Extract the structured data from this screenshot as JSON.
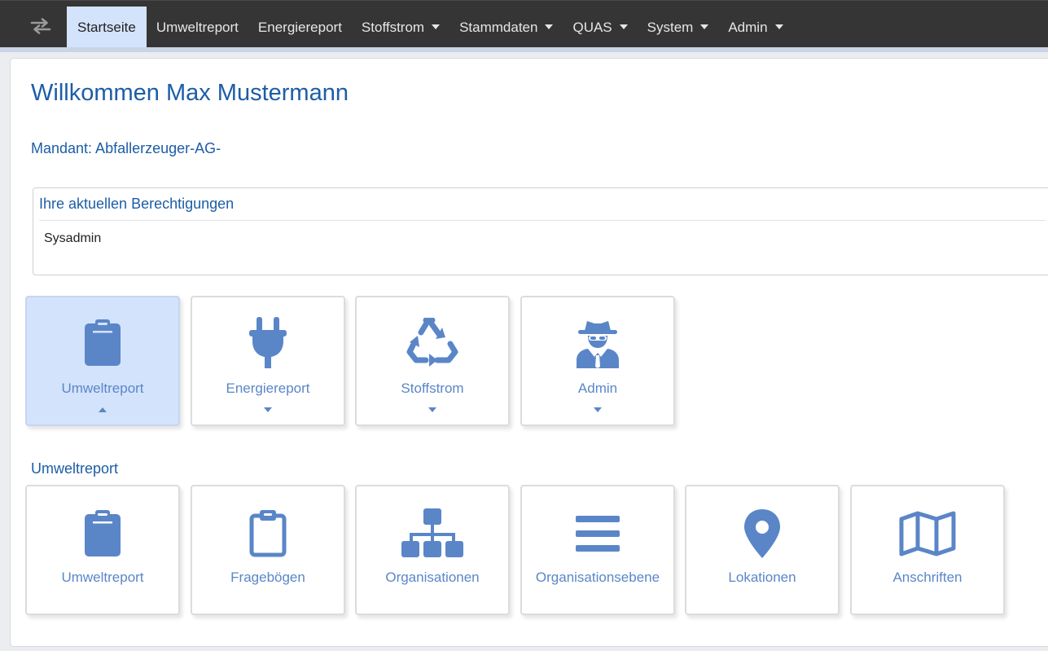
{
  "nav": {
    "toggle_icon": "exchange-arrows-icon",
    "items": [
      {
        "label": "Startseite",
        "active": true,
        "dropdown": false
      },
      {
        "label": "Umweltreport",
        "dropdown": false
      },
      {
        "label": "Energiereport",
        "dropdown": false
      },
      {
        "label": "Stoffstrom",
        "dropdown": true
      },
      {
        "label": "Stammdaten",
        "dropdown": true
      },
      {
        "label": "QUAS",
        "dropdown": true
      },
      {
        "label": "System",
        "dropdown": true
      },
      {
        "label": "Admin",
        "dropdown": true
      }
    ]
  },
  "welcome": "Willkommen Max Mustermann",
  "mandant": "Mandant: Abfallerzeuger-AG-",
  "permissions": {
    "title": "Ihre aktuellen Berechtigungen",
    "value": "Sysadmin"
  },
  "modules": [
    {
      "label": "Umweltreport",
      "icon": "clipboard-icon",
      "expanded": true
    },
    {
      "label": "Energiereport",
      "icon": "plug-icon",
      "expanded": false
    },
    {
      "label": "Stoffstrom",
      "icon": "recycle-icon",
      "expanded": false
    },
    {
      "label": "Admin",
      "icon": "user-secret-icon",
      "expanded": false
    }
  ],
  "section": {
    "title": "Umweltreport",
    "items": [
      {
        "label": "Umweltreport",
        "icon": "clipboard-icon"
      },
      {
        "label": "Fragebögen",
        "icon": "clipboard-outline-icon"
      },
      {
        "label": "Organisationen",
        "icon": "sitemap-icon"
      },
      {
        "label": "Organisationsebene",
        "icon": "bars-icon"
      },
      {
        "label": "Lokationen",
        "icon": "map-marker-icon"
      },
      {
        "label": "Anschriften",
        "icon": "map-icon"
      }
    ]
  },
  "colors": {
    "accent": "#1d5da6",
    "icon": "#5a86c8",
    "active_bg": "#d3e3fb",
    "navbar": "#353535"
  }
}
